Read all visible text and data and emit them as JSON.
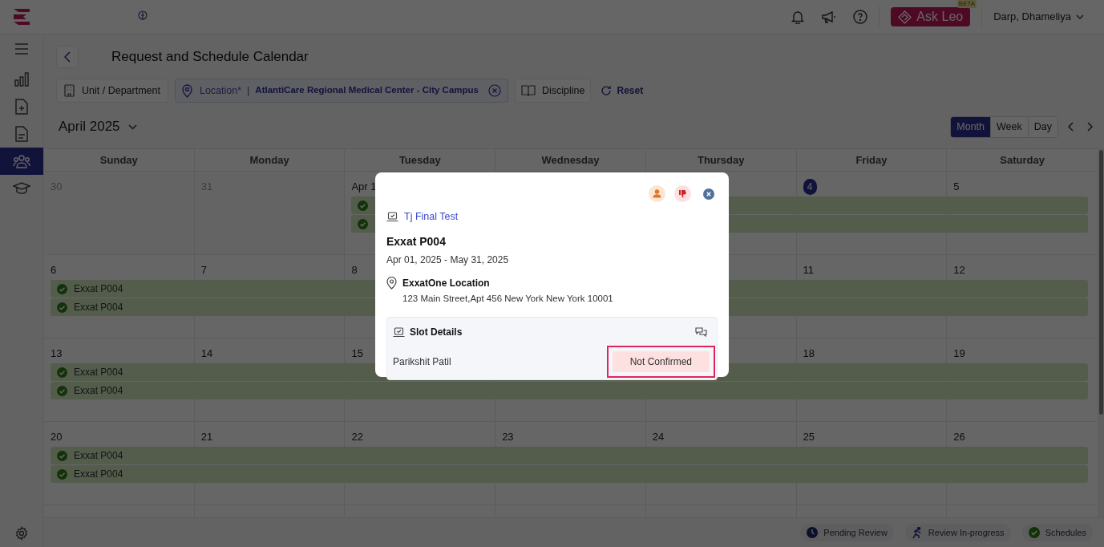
{
  "topbar": {
    "user": "Darp, Dhameliya",
    "ask_button": "Ask Leo",
    "ask_badge": "BETA"
  },
  "sidebar": {
    "items": [
      {
        "kind": "chart",
        "selected": false
      },
      {
        "kind": "file-plus",
        "selected": false
      },
      {
        "kind": "document",
        "selected": false
      },
      {
        "kind": "people",
        "selected": true
      },
      {
        "kind": "graduation",
        "selected": false
      }
    ]
  },
  "page": {
    "title": "Request and Schedule Calendar"
  },
  "filters": {
    "unit": "Unit / Department",
    "location_label": "Location*",
    "separator": "|",
    "location_value": "AtlantiCare Regional Medical Center - City Campus",
    "discipline": "Discipline",
    "reset": "Reset"
  },
  "calendar": {
    "month": "April 2025",
    "views": [
      {
        "label": "Month",
        "selected": true
      },
      {
        "label": "Week",
        "selected": false
      },
      {
        "label": "Day",
        "selected": false
      }
    ],
    "weekdays": [
      "Sunday",
      "Monday",
      "Tuesday",
      "Wednesday",
      "Thursday",
      "Friday",
      "Saturday"
    ],
    "weeks": [
      {
        "days_left": [
          {
            "label": "30",
            "muted": true,
            "today": false,
            "in_bars": false
          },
          {
            "label": "31",
            "muted": true,
            "today": false,
            "in_bars": false
          },
          {
            "label": "Apr 1",
            "muted": false,
            "today": false,
            "in_bars": true
          }
        ],
        "days_right": [
          {
            "label": "4",
            "muted": false,
            "today": true,
            "in_bars": true
          },
          {
            "label": "5",
            "muted": false,
            "today": false,
            "in_bars": true
          }
        ],
        "bars": [
          {
            "kind": "confirmed"
          },
          {
            "kind": "confirmed"
          }
        ]
      },
      {
        "days_left": [
          {
            "label": "6",
            "muted": false,
            "today": false,
            "in_bars": true
          },
          {
            "label": "7",
            "muted": false,
            "today": false,
            "in_bars": true
          },
          {
            "label": "8",
            "muted": false,
            "today": false,
            "in_bars": true
          }
        ],
        "days_right": [
          {
            "label": "11",
            "muted": false,
            "today": false,
            "in_bars": true
          },
          {
            "label": "12",
            "muted": false,
            "today": false,
            "in_bars": true
          }
        ],
        "bars": [
          {
            "label": "Exxat P004",
            "kind": "confirmed"
          },
          {
            "label": "Exxat P004",
            "kind": "confirmed"
          }
        ]
      },
      {
        "days_left": [
          {
            "label": "13",
            "muted": false,
            "today": false,
            "in_bars": true
          },
          {
            "label": "14",
            "muted": false,
            "today": false,
            "in_bars": true
          },
          {
            "label": "15",
            "muted": false,
            "today": false,
            "in_bars": true
          }
        ],
        "days_right": [
          {
            "label": "18",
            "muted": false,
            "today": false,
            "in_bars": true
          },
          {
            "label": "19",
            "muted": false,
            "today": false,
            "in_bars": true
          }
        ],
        "bars": [
          {
            "label": "Exxat P004",
            "kind": "confirmed"
          },
          {
            "label": "Exxat P004",
            "kind": "confirmed"
          }
        ]
      },
      {
        "days": [
          {
            "label": "20",
            "muted": false,
            "today": false,
            "in_bars": true
          },
          {
            "label": "21",
            "muted": false,
            "today": false,
            "in_bars": true
          },
          {
            "label": "22",
            "muted": false,
            "today": false,
            "in_bars": true
          },
          {
            "label": "23",
            "muted": false,
            "today": false,
            "in_bars": true
          },
          {
            "label": "24",
            "muted": false,
            "today": false,
            "in_bars": true
          },
          {
            "label": "25",
            "muted": false,
            "today": false,
            "in_bars": true
          },
          {
            "label": "26",
            "muted": false,
            "today": false,
            "in_bars": true
          }
        ],
        "bars": [
          {
            "label": "Exxat P004",
            "kind": "confirmed"
          },
          {
            "label": "Exxat P004",
            "kind": "confirmed"
          }
        ]
      }
    ]
  },
  "legend": [
    {
      "kind": "pending",
      "label": "Pending Review"
    },
    {
      "kind": "in-progress",
      "label": "Review In-progress"
    },
    {
      "kind": "schedules",
      "label": "Schedules"
    }
  ],
  "modal": {
    "link": "Tj Final Test",
    "name": "Exxat P004",
    "dates": "Apr 01, 2025 - May 31, 2025",
    "location_name": "ExxatOne Location",
    "address": "123 Main Street,Apt 456 New York New York 10001",
    "slot_details": {
      "title": "Slot Details",
      "rows": [
        {
          "name": "Parikshit Patil",
          "status": "Not Confirmed",
          "highlighted": true
        }
      ]
    }
  }
}
